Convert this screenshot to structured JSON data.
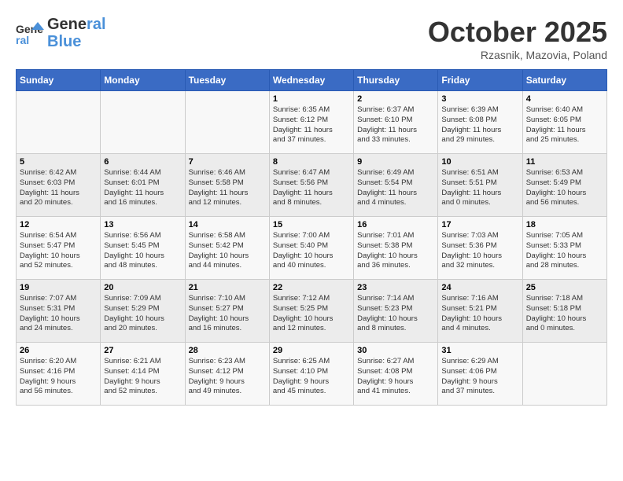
{
  "header": {
    "logo_line1": "General",
    "logo_line2": "Blue",
    "month": "October 2025",
    "location": "Rzasnik, Mazovia, Poland"
  },
  "weekdays": [
    "Sunday",
    "Monday",
    "Tuesday",
    "Wednesday",
    "Thursday",
    "Friday",
    "Saturday"
  ],
  "weeks": [
    [
      {
        "day": "",
        "info": ""
      },
      {
        "day": "",
        "info": ""
      },
      {
        "day": "",
        "info": ""
      },
      {
        "day": "1",
        "info": "Sunrise: 6:35 AM\nSunset: 6:12 PM\nDaylight: 11 hours\nand 37 minutes."
      },
      {
        "day": "2",
        "info": "Sunrise: 6:37 AM\nSunset: 6:10 PM\nDaylight: 11 hours\nand 33 minutes."
      },
      {
        "day": "3",
        "info": "Sunrise: 6:39 AM\nSunset: 6:08 PM\nDaylight: 11 hours\nand 29 minutes."
      },
      {
        "day": "4",
        "info": "Sunrise: 6:40 AM\nSunset: 6:05 PM\nDaylight: 11 hours\nand 25 minutes."
      }
    ],
    [
      {
        "day": "5",
        "info": "Sunrise: 6:42 AM\nSunset: 6:03 PM\nDaylight: 11 hours\nand 20 minutes."
      },
      {
        "day": "6",
        "info": "Sunrise: 6:44 AM\nSunset: 6:01 PM\nDaylight: 11 hours\nand 16 minutes."
      },
      {
        "day": "7",
        "info": "Sunrise: 6:46 AM\nSunset: 5:58 PM\nDaylight: 11 hours\nand 12 minutes."
      },
      {
        "day": "8",
        "info": "Sunrise: 6:47 AM\nSunset: 5:56 PM\nDaylight: 11 hours\nand 8 minutes."
      },
      {
        "day": "9",
        "info": "Sunrise: 6:49 AM\nSunset: 5:54 PM\nDaylight: 11 hours\nand 4 minutes."
      },
      {
        "day": "10",
        "info": "Sunrise: 6:51 AM\nSunset: 5:51 PM\nDaylight: 11 hours\nand 0 minutes."
      },
      {
        "day": "11",
        "info": "Sunrise: 6:53 AM\nSunset: 5:49 PM\nDaylight: 10 hours\nand 56 minutes."
      }
    ],
    [
      {
        "day": "12",
        "info": "Sunrise: 6:54 AM\nSunset: 5:47 PM\nDaylight: 10 hours\nand 52 minutes."
      },
      {
        "day": "13",
        "info": "Sunrise: 6:56 AM\nSunset: 5:45 PM\nDaylight: 10 hours\nand 48 minutes."
      },
      {
        "day": "14",
        "info": "Sunrise: 6:58 AM\nSunset: 5:42 PM\nDaylight: 10 hours\nand 44 minutes."
      },
      {
        "day": "15",
        "info": "Sunrise: 7:00 AM\nSunset: 5:40 PM\nDaylight: 10 hours\nand 40 minutes."
      },
      {
        "day": "16",
        "info": "Sunrise: 7:01 AM\nSunset: 5:38 PM\nDaylight: 10 hours\nand 36 minutes."
      },
      {
        "day": "17",
        "info": "Sunrise: 7:03 AM\nSunset: 5:36 PM\nDaylight: 10 hours\nand 32 minutes."
      },
      {
        "day": "18",
        "info": "Sunrise: 7:05 AM\nSunset: 5:33 PM\nDaylight: 10 hours\nand 28 minutes."
      }
    ],
    [
      {
        "day": "19",
        "info": "Sunrise: 7:07 AM\nSunset: 5:31 PM\nDaylight: 10 hours\nand 24 minutes."
      },
      {
        "day": "20",
        "info": "Sunrise: 7:09 AM\nSunset: 5:29 PM\nDaylight: 10 hours\nand 20 minutes."
      },
      {
        "day": "21",
        "info": "Sunrise: 7:10 AM\nSunset: 5:27 PM\nDaylight: 10 hours\nand 16 minutes."
      },
      {
        "day": "22",
        "info": "Sunrise: 7:12 AM\nSunset: 5:25 PM\nDaylight: 10 hours\nand 12 minutes."
      },
      {
        "day": "23",
        "info": "Sunrise: 7:14 AM\nSunset: 5:23 PM\nDaylight: 10 hours\nand 8 minutes."
      },
      {
        "day": "24",
        "info": "Sunrise: 7:16 AM\nSunset: 5:21 PM\nDaylight: 10 hours\nand 4 minutes."
      },
      {
        "day": "25",
        "info": "Sunrise: 7:18 AM\nSunset: 5:18 PM\nDaylight: 10 hours\nand 0 minutes."
      }
    ],
    [
      {
        "day": "26",
        "info": "Sunrise: 6:20 AM\nSunset: 4:16 PM\nDaylight: 9 hours\nand 56 minutes."
      },
      {
        "day": "27",
        "info": "Sunrise: 6:21 AM\nSunset: 4:14 PM\nDaylight: 9 hours\nand 52 minutes."
      },
      {
        "day": "28",
        "info": "Sunrise: 6:23 AM\nSunset: 4:12 PM\nDaylight: 9 hours\nand 49 minutes."
      },
      {
        "day": "29",
        "info": "Sunrise: 6:25 AM\nSunset: 4:10 PM\nDaylight: 9 hours\nand 45 minutes."
      },
      {
        "day": "30",
        "info": "Sunrise: 6:27 AM\nSunset: 4:08 PM\nDaylight: 9 hours\nand 41 minutes."
      },
      {
        "day": "31",
        "info": "Sunrise: 6:29 AM\nSunset: 4:06 PM\nDaylight: 9 hours\nand 37 minutes."
      },
      {
        "day": "",
        "info": ""
      }
    ]
  ]
}
